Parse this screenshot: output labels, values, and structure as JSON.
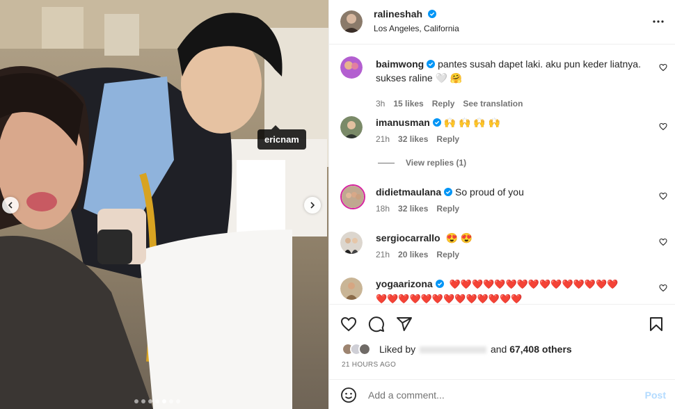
{
  "post": {
    "username": "ralineshah",
    "location": "Los Angeles, California",
    "photo_tag": "ericnam",
    "carousel_dots": 7,
    "carousel_active": 4
  },
  "comments": [
    {
      "username": "baimwong",
      "verified": true,
      "text": "pantes susah dapet laki. aku pun keder liatnya. sukses raline 🤍 🤗",
      "time": "3h",
      "likes": "15 likes",
      "reply": "Reply",
      "translate": "See translation"
    },
    {
      "username": "imanusman",
      "verified": true,
      "text": "🙌 🙌 🙌 🙌",
      "time": "21h",
      "likes": "32 likes",
      "reply": "Reply"
    },
    {
      "username": "didietmaulana",
      "verified": true,
      "text": "So proud of you",
      "time": "18h",
      "likes": "32 likes",
      "reply": "Reply"
    },
    {
      "username": "sergiocarrallo",
      "verified": false,
      "text": "😍 😍",
      "time": "21h",
      "likes": "20 likes",
      "reply": "Reply"
    },
    {
      "username": "yogaarizona",
      "verified": true,
      "text": "❤️❤️❤️❤️❤️❤️❤️❤️❤️❤️❤️❤️❤️❤️❤️❤️❤️❤️❤️❤️❤️❤️❤️❤️❤️❤️❤️❤️"
    }
  ],
  "view_replies": "View replies (1)",
  "liked_by_prefix": "Liked by",
  "liked_by_suffix": "and",
  "likes_count": "67,408 others",
  "time_ago": "21 HOURS AGO",
  "comment_placeholder": "Add a comment...",
  "post_button": "Post",
  "icons": {
    "more": "more-icon",
    "like": "heart-icon",
    "comment": "comment-icon",
    "share": "share-icon",
    "save": "bookmark-icon",
    "emoji": "emoji-icon",
    "verified": "verified-badge-icon"
  },
  "colors": {
    "verified": "#0095f6",
    "post_disabled": "#b3dbff",
    "heart": "#ed1c24"
  }
}
